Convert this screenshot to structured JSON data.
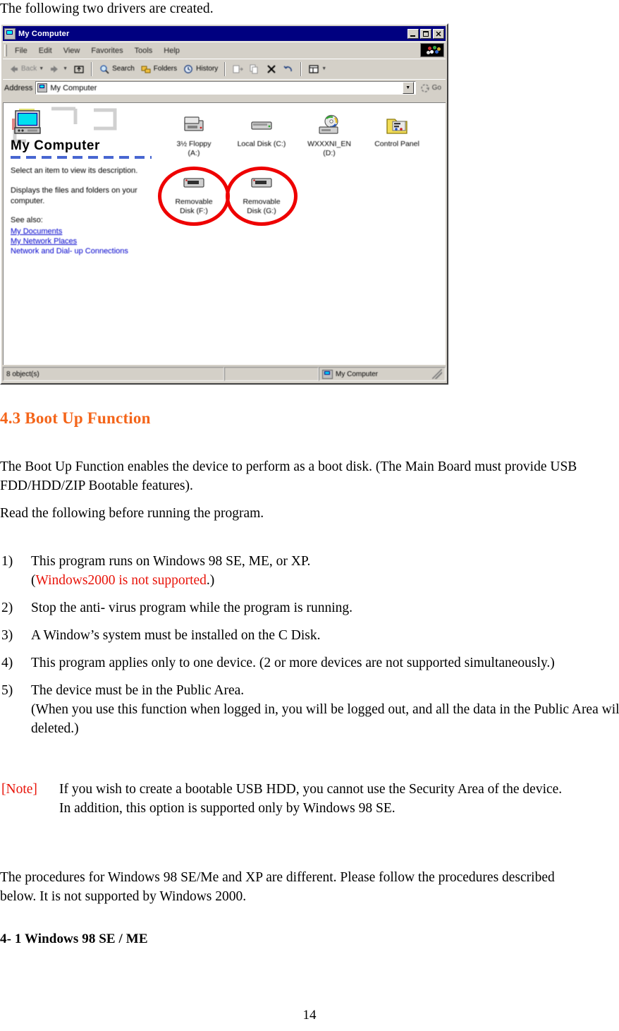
{
  "document": {
    "intro_line": "The following two drivers are created.",
    "heading_4_3": "4.3 Boot Up Function",
    "para_1": "The Boot Up Function enables the device to perform as a boot disk. (The Main Board must provide USB FDD/HDD/ZIP Bootable features).",
    "para_2": "Read the following before running the program.",
    "list": [
      {
        "num": "1)",
        "text_before": "This program runs on Windows 98 SE, ME, or XP.",
        "line2_open": "(",
        "line2_red": "Windows2000 is not supported",
        "line2_close": ".)"
      },
      {
        "num": "2)",
        "text_before": "Stop the anti- virus program while the program is running."
      },
      {
        "num": "3)",
        "text_before": "A Window’s system must be installed on the C Disk."
      },
      {
        "num": "4)",
        "text_before": "This program applies only to one device. (2 or more devices are not supported simultaneously.)"
      },
      {
        "num": "5)",
        "text_before": "The device must be in the Public Area.",
        "line2": "(When you use this function when logged in, you will be logged out, and all the data in the Public Area will be deleted.)"
      }
    ],
    "note": {
      "tag": "[Note]",
      "line1": "If you wish to create a bootable USB HDD, you cannot use the Security Area of the device.",
      "line2": "In addition, this option is supported only by Windows 98 SE."
    },
    "para_3": "The procedures for Windows 98 SE/Me and XP are different. Please follow the procedures described below. It is not supported by Windows 2000.",
    "heading_4_1": "4- 1 Windows 98 SE / ME",
    "page_number": "14"
  },
  "screenshot": {
    "window_title": "My Computer",
    "window_icon": "my-computer-icon",
    "window_buttons": {
      "minimize": "_",
      "maximize": "□",
      "close": "✕"
    },
    "menu": [
      "File",
      "Edit",
      "View",
      "Favorites",
      "Tools",
      "Help"
    ],
    "toolbar": [
      {
        "icon": "back-arrow-icon",
        "label": "Back",
        "has_caret": true,
        "dim": true
      },
      {
        "icon": "forward-arrow-icon",
        "label": "",
        "has_caret": true,
        "dim": true
      },
      {
        "icon": "up-folder-icon",
        "label": "",
        "has_caret": false,
        "dim": false
      },
      {
        "icon": "search-icon",
        "label": "Search",
        "has_caret": false,
        "dim": false
      },
      {
        "icon": "folders-icon",
        "label": "Folders",
        "has_caret": false,
        "dim": false
      },
      {
        "icon": "history-icon",
        "label": "History",
        "has_caret": false,
        "dim": false
      },
      {
        "icon": "move-to-icon",
        "label": "",
        "has_caret": false,
        "dim": true
      },
      {
        "icon": "copy-to-icon",
        "label": "",
        "has_caret": false,
        "dim": true
      },
      {
        "icon": "delete-icon",
        "label": "",
        "has_caret": false,
        "dim": false
      },
      {
        "icon": "undo-icon",
        "label": "",
        "has_caret": false,
        "dim": false
      },
      {
        "icon": "views-icon",
        "label": "",
        "has_caret": true,
        "dim": false
      }
    ],
    "address": {
      "label": "Address",
      "value": "My Computer",
      "go_label": "Go",
      "go_icon": "go-icon"
    },
    "left_pane": {
      "banner_title": "My Computer",
      "desc_1": "Select an item to view its description.",
      "desc_2": "Displays the files and folders on your computer.",
      "see_also_label": "See also:",
      "links": [
        "My Documents",
        "My Network Places",
        "Network and Dial- up Connections"
      ]
    },
    "drives": {
      "row1": [
        {
          "icon": "floppy-drive-icon",
          "line1": "3½ Floppy",
          "line2": "(A:)",
          "circled": false
        },
        {
          "icon": "hard-disk-icon",
          "line1": "Local Disk (C:)",
          "line2": "",
          "circled": false
        },
        {
          "icon": "cd-drive-icon",
          "line1": "WXXXNI_EN",
          "line2": "(D:)",
          "circled": false
        },
        {
          "icon": "control-panel-icon",
          "line1": "Control Panel",
          "line2": "",
          "circled": false
        }
      ],
      "row2": [
        {
          "icon": "removable-disk-icon",
          "line1": "Removable",
          "line2": "Disk (F:)",
          "circled": true
        },
        {
          "icon": "removable-disk-icon",
          "line1": "Removable",
          "line2": "Disk (G:)",
          "circled": true
        }
      ]
    },
    "status_bar": {
      "objects": "8 object(s)",
      "middle": "",
      "computer": "My Computer",
      "computer_icon": "my-computer-small-icon"
    },
    "colors": {
      "titlebar": "#000080",
      "chrome": "#d4d0c8",
      "annotation_circle": "#ee0000",
      "link": "#0000cc"
    }
  },
  "colors": {
    "heading_orange": "#F4651A",
    "warning_red": "#E8140A",
    "text": "#000000"
  }
}
